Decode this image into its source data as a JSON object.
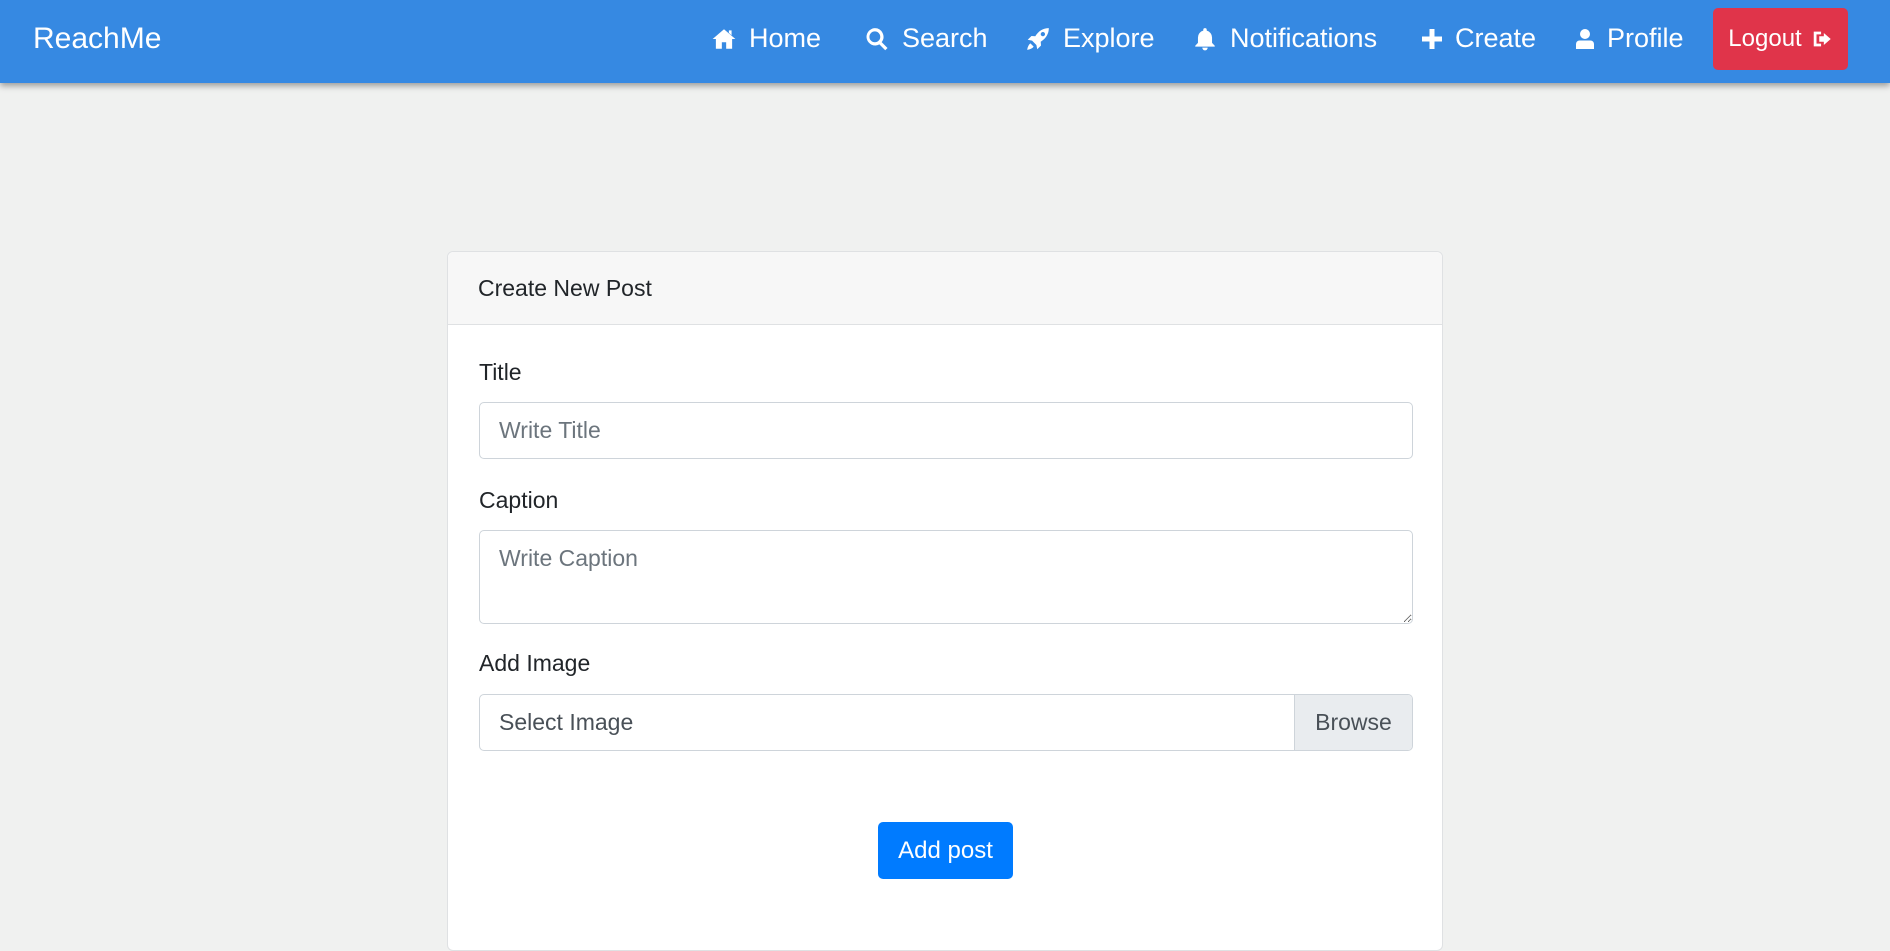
{
  "navbar": {
    "brand": "ReachMe",
    "background_color": "#3689e2",
    "items": [
      {
        "label": "Home",
        "icon": "home-icon"
      },
      {
        "label": "Search",
        "icon": "search-icon"
      },
      {
        "label": "Explore",
        "icon": "rocket-icon"
      },
      {
        "label": "Notifications",
        "icon": "bell-icon"
      },
      {
        "label": "Create",
        "icon": "plus-icon"
      },
      {
        "label": "Profile",
        "icon": "user-icon"
      }
    ],
    "logout": {
      "label": "Logout",
      "icon": "sign-out-icon",
      "color": "#e0344a"
    }
  },
  "form": {
    "header": "Create New Post",
    "title_label": "Title",
    "title_placeholder": "Write Title",
    "title_value": "",
    "caption_label": "Caption",
    "caption_placeholder": "Write Caption",
    "caption_value": "",
    "image_label": "Add Image",
    "image_text": "Select Image",
    "browse_label": "Browse",
    "submit_label": "Add post",
    "submit_color": "#007bff"
  }
}
